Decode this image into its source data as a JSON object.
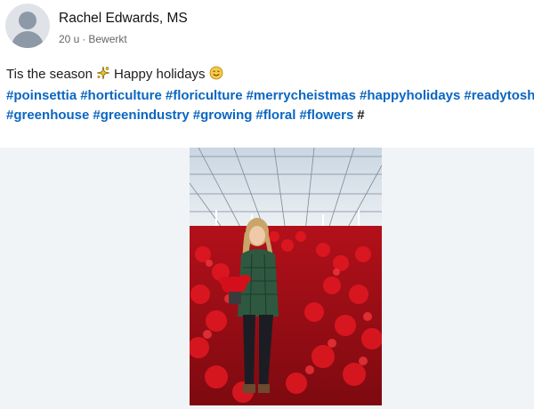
{
  "post": {
    "author_name": "Rachel Edwards, MS",
    "time": "20 u",
    "separator": "·",
    "edited": "Bewerkt",
    "text_start": "Tis the season",
    "text_end": "Happy holidays",
    "hashtags_line1": [
      "#poinsettia",
      "#horticulture",
      "#floriculture",
      "#merrycheistmas",
      "#happyholidays",
      "#readytoship"
    ],
    "hashtags_line2": [
      "#greenhouse",
      "#greenindustry",
      "#growing",
      "#floral",
      "#flowers"
    ],
    "trailing_hash": "#"
  },
  "icons": {
    "avatar": "person-silhouette-icon",
    "emoji1": "sparkle-emoji-icon",
    "emoji2": "smiling-face-icon"
  },
  "colors": {
    "hashtag": "#0a66c2",
    "media_background": "#f1f4f7",
    "poinsettia_red": "#c8101a"
  }
}
